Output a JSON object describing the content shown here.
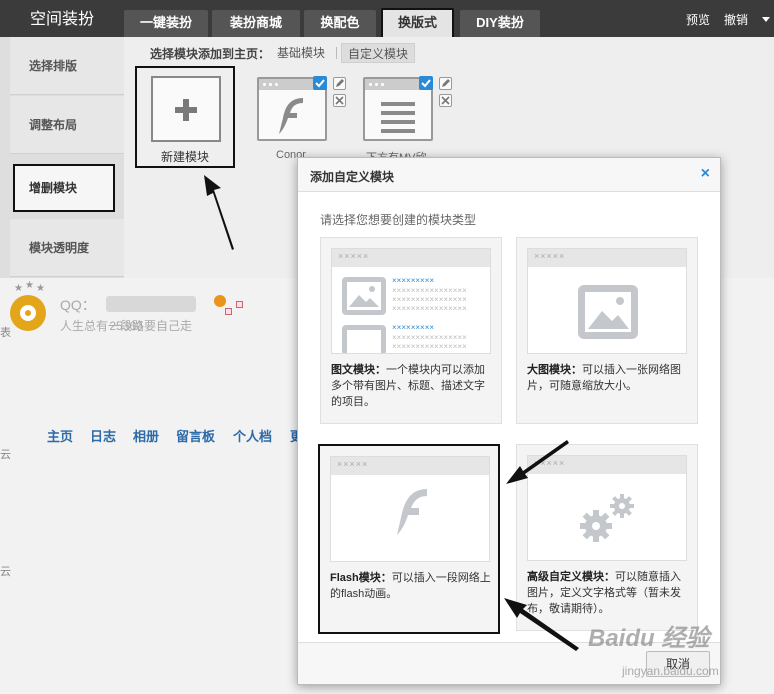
{
  "app": {
    "title": "空间装扮"
  },
  "tabs": [
    {
      "label": "一键装扮"
    },
    {
      "label": "装扮商城"
    },
    {
      "label": "换配色"
    },
    {
      "label": "换版式"
    },
    {
      "label": "DIY装扮"
    }
  ],
  "top_links": {
    "preview": "预览",
    "undo": "撤销"
  },
  "sidebar": {
    "items": [
      {
        "label": "选择排版"
      },
      {
        "label": "调整布局"
      },
      {
        "label": "增删模块"
      },
      {
        "label": "模块透明度"
      }
    ]
  },
  "panel": {
    "heading": "选择模块添加到主页：",
    "subtabs": [
      {
        "label": "基础模块"
      },
      {
        "label": "自定义模块"
      }
    ],
    "new_module_label": "新建模块",
    "modules": [
      {
        "label": "Conor"
      },
      {
        "label": "下方有MV欣"
      }
    ]
  },
  "profile": {
    "qq_prefix": "QQ：",
    "motto": "人生总有一段路要自己走",
    "motto_number": "25360"
  },
  "main_nav": [
    "主页",
    "日志",
    "相册",
    "留言板",
    "个人档",
    "更"
  ],
  "left_edge_marks": [
    "表",
    "云",
    "云"
  ],
  "dialog": {
    "title": "添加自定义模块",
    "close_icon": "×",
    "prompt": "请选择您想要创建的模块类型",
    "placeholder_stars": "×××××",
    "link_text": "×××××××××",
    "lines_text": "××××××××××××××××",
    "cards": [
      {
        "name": "图文模块",
        "sep": "：",
        "desc": "一个模块内可以添加多个带有图片、标题、描述文字的项目。"
      },
      {
        "name": "大图模块",
        "sep": "：",
        "desc": "可以插入一张网络图片，可随意缩放大小。"
      },
      {
        "name": "Flash模块",
        "sep": "：",
        "desc": "可以插入一段网络上的flash动画。"
      },
      {
        "name": "高级自定义模块",
        "sep": "：",
        "desc": "可以随意插入图片，定义文字格式等（暂未发布，敬请期待）。"
      }
    ],
    "cancel_label": "取消"
  },
  "watermark": {
    "main": "Baidu 经验",
    "sub": "jingyan.baidu.com"
  },
  "colors": {
    "accent": "#2a8ad6",
    "topbar": "#3b3b3b",
    "nav_link": "#2c6aa8"
  }
}
